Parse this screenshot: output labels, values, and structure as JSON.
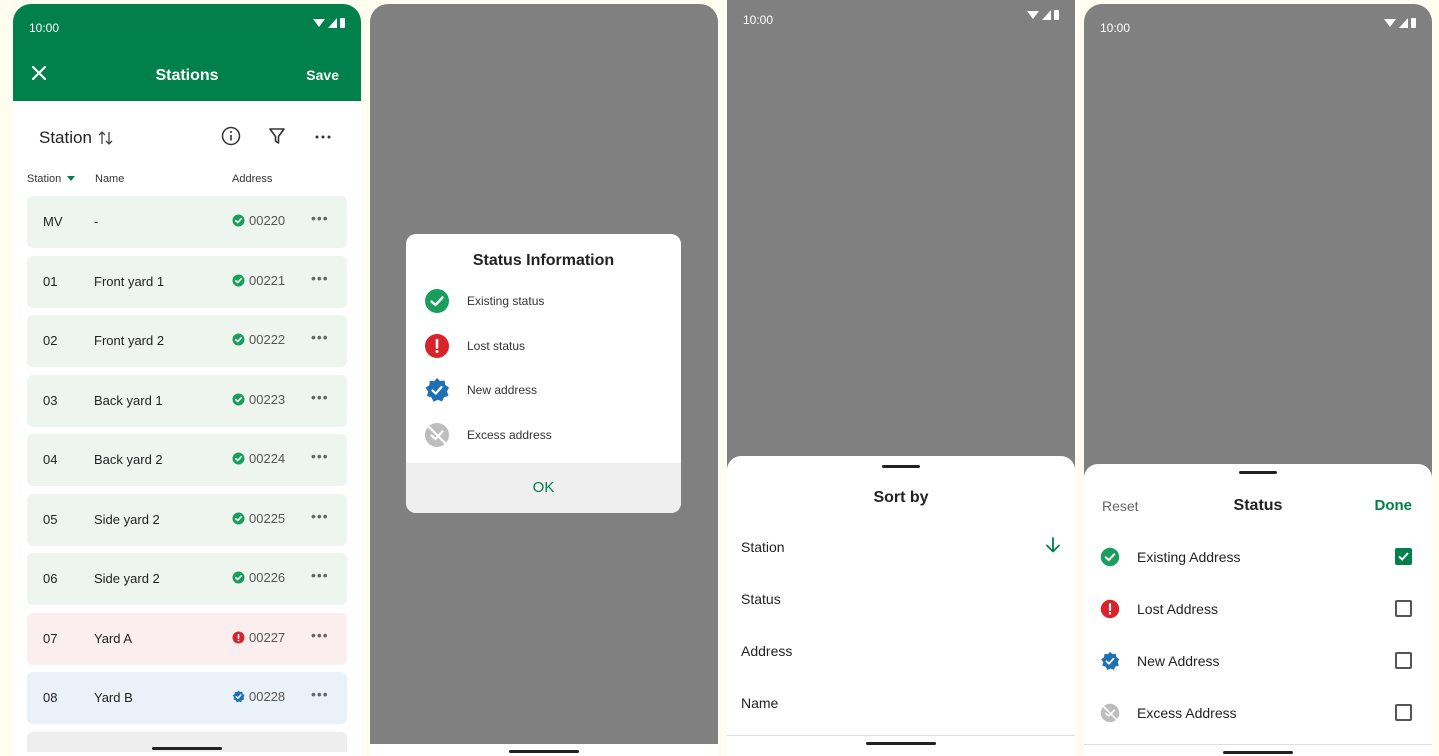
{
  "screen1": {
    "status_bar": {
      "time": "10:00"
    },
    "app_bar": {
      "title": "Stations",
      "save_label": "Save"
    },
    "sort_label": "Station",
    "columns": {
      "station": "Station",
      "name": "Name",
      "address": "Address"
    },
    "rows": [
      {
        "station": "MV",
        "name": "-",
        "address": "00220",
        "status": "existing"
      },
      {
        "station": "01",
        "name": "Front yard 1",
        "address": "00221",
        "status": "existing"
      },
      {
        "station": "02",
        "name": "Front yard 2",
        "address": "00222",
        "status": "existing"
      },
      {
        "station": "03",
        "name": "Back yard 1",
        "address": "00223",
        "status": "existing"
      },
      {
        "station": "04",
        "name": "Back yard 2",
        "address": "00224",
        "status": "existing"
      },
      {
        "station": "05",
        "name": "Side yard 2",
        "address": "00225",
        "status": "existing"
      },
      {
        "station": "06",
        "name": "Side yard 2",
        "address": "00226",
        "status": "existing"
      },
      {
        "station": "07",
        "name": "Yard A",
        "address": "00227",
        "status": "lost"
      },
      {
        "station": "08",
        "name": "Yard B",
        "address": "00228",
        "status": "new"
      }
    ],
    "more_label": "•••"
  },
  "screen2": {
    "dialog": {
      "title": "Status Information",
      "items": [
        "Existing status",
        "Lost status",
        "New address",
        "Excess address"
      ],
      "ok_label": "OK"
    }
  },
  "screen3": {
    "status_bar": {
      "time": "10:00"
    },
    "sheet": {
      "title": "Sort by",
      "options": [
        "Station",
        "Status",
        "Address",
        "Name"
      ],
      "selected": "Station"
    }
  },
  "screen4": {
    "status_bar": {
      "time": "10:00"
    },
    "sheet": {
      "reset_label": "Reset",
      "title": "Status",
      "done_label": "Done",
      "options": [
        {
          "label": "Existing Address",
          "checked": true
        },
        {
          "label": "Lost Address",
          "checked": false
        },
        {
          "label": "New Address",
          "checked": false
        },
        {
          "label": "Excess Address",
          "checked": false
        }
      ]
    }
  },
  "colors": {
    "brand_green": "#00804a",
    "existing": "#1a9e5c",
    "lost": "#d8232a",
    "new": "#1f6fb5",
    "excess": "#bdbdbd"
  }
}
